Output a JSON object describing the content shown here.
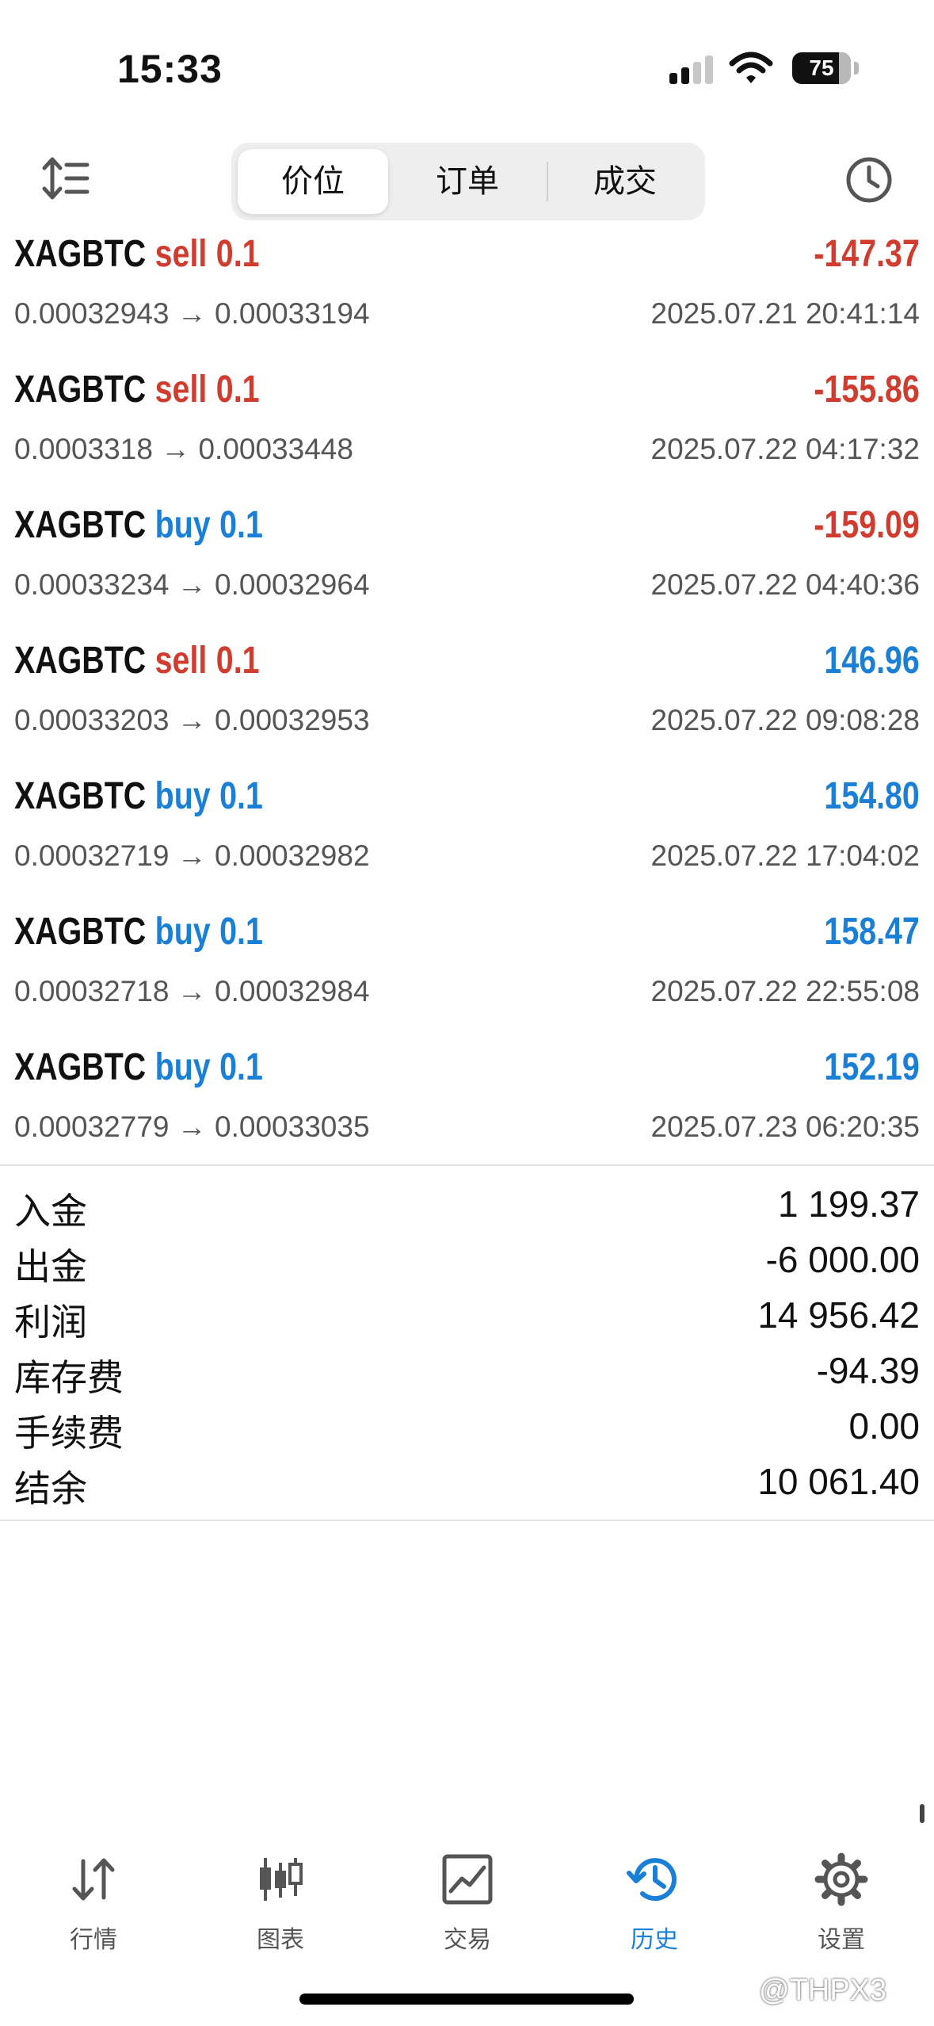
{
  "status_bar": {
    "time": "15:33",
    "battery": "75"
  },
  "colors": {
    "sell": "#d23c2e",
    "buy": "#1a7fd6",
    "negative_profit": "#d23c2e",
    "positive_profit": "#1a7fd6",
    "accent": "#1a7fd6"
  },
  "toolbar": {
    "sort_icon": "sort-arrows-icon",
    "clock_icon": "clock-icon",
    "segments": [
      {
        "label": "价位",
        "active": true
      },
      {
        "label": "订单",
        "active": false
      },
      {
        "label": "成交",
        "active": false
      }
    ]
  },
  "deals": [
    {
      "symbol": "XAGBTC",
      "side": "sell",
      "volume": "0.1",
      "profit": "-147.37",
      "prices": "0.00032943 → 0.00033194",
      "time": "2025.07.21 20:41:14"
    },
    {
      "symbol": "XAGBTC",
      "side": "sell",
      "volume": "0.1",
      "profit": "-155.86",
      "prices": "0.0003318 → 0.00033448",
      "time": "2025.07.22 04:17:32"
    },
    {
      "symbol": "XAGBTC",
      "side": "buy",
      "volume": "0.1",
      "profit": "-159.09",
      "prices": "0.00033234 → 0.00032964",
      "time": "2025.07.22 04:40:36"
    },
    {
      "symbol": "XAGBTC",
      "side": "sell",
      "volume": "0.1",
      "profit": "146.96",
      "prices": "0.00033203 → 0.00032953",
      "time": "2025.07.22 09:08:28"
    },
    {
      "symbol": "XAGBTC",
      "side": "buy",
      "volume": "0.1",
      "profit": "154.80",
      "prices": "0.00032719 → 0.00032982",
      "time": "2025.07.22 17:04:02"
    },
    {
      "symbol": "XAGBTC",
      "side": "buy",
      "volume": "0.1",
      "profit": "158.47",
      "prices": "0.00032718 → 0.00032984",
      "time": "2025.07.22 22:55:08"
    },
    {
      "symbol": "XAGBTC",
      "side": "buy",
      "volume": "0.1",
      "profit": "152.19",
      "prices": "0.00032779 → 0.00033035",
      "time": "2025.07.23 06:20:35"
    }
  ],
  "summary": [
    {
      "label": "入金",
      "value": "1 199.37"
    },
    {
      "label": "出金",
      "value": "-6 000.00"
    },
    {
      "label": "利润",
      "value": "14 956.42"
    },
    {
      "label": "库存费",
      "value": "-94.39"
    },
    {
      "label": "手续费",
      "value": "0.00"
    },
    {
      "label": "结余",
      "value": "10 061.40"
    }
  ],
  "tabs": [
    {
      "label": "行情",
      "icon": "quotes-arrows-icon",
      "active": false
    },
    {
      "label": "图表",
      "icon": "candlestick-chart-icon",
      "active": false
    },
    {
      "label": "交易",
      "icon": "trade-chart-icon",
      "active": false
    },
    {
      "label": "历史",
      "icon": "history-icon",
      "active": true
    },
    {
      "label": "设置",
      "icon": "gear-icon",
      "active": false
    }
  ],
  "watermark": "@THPX3"
}
